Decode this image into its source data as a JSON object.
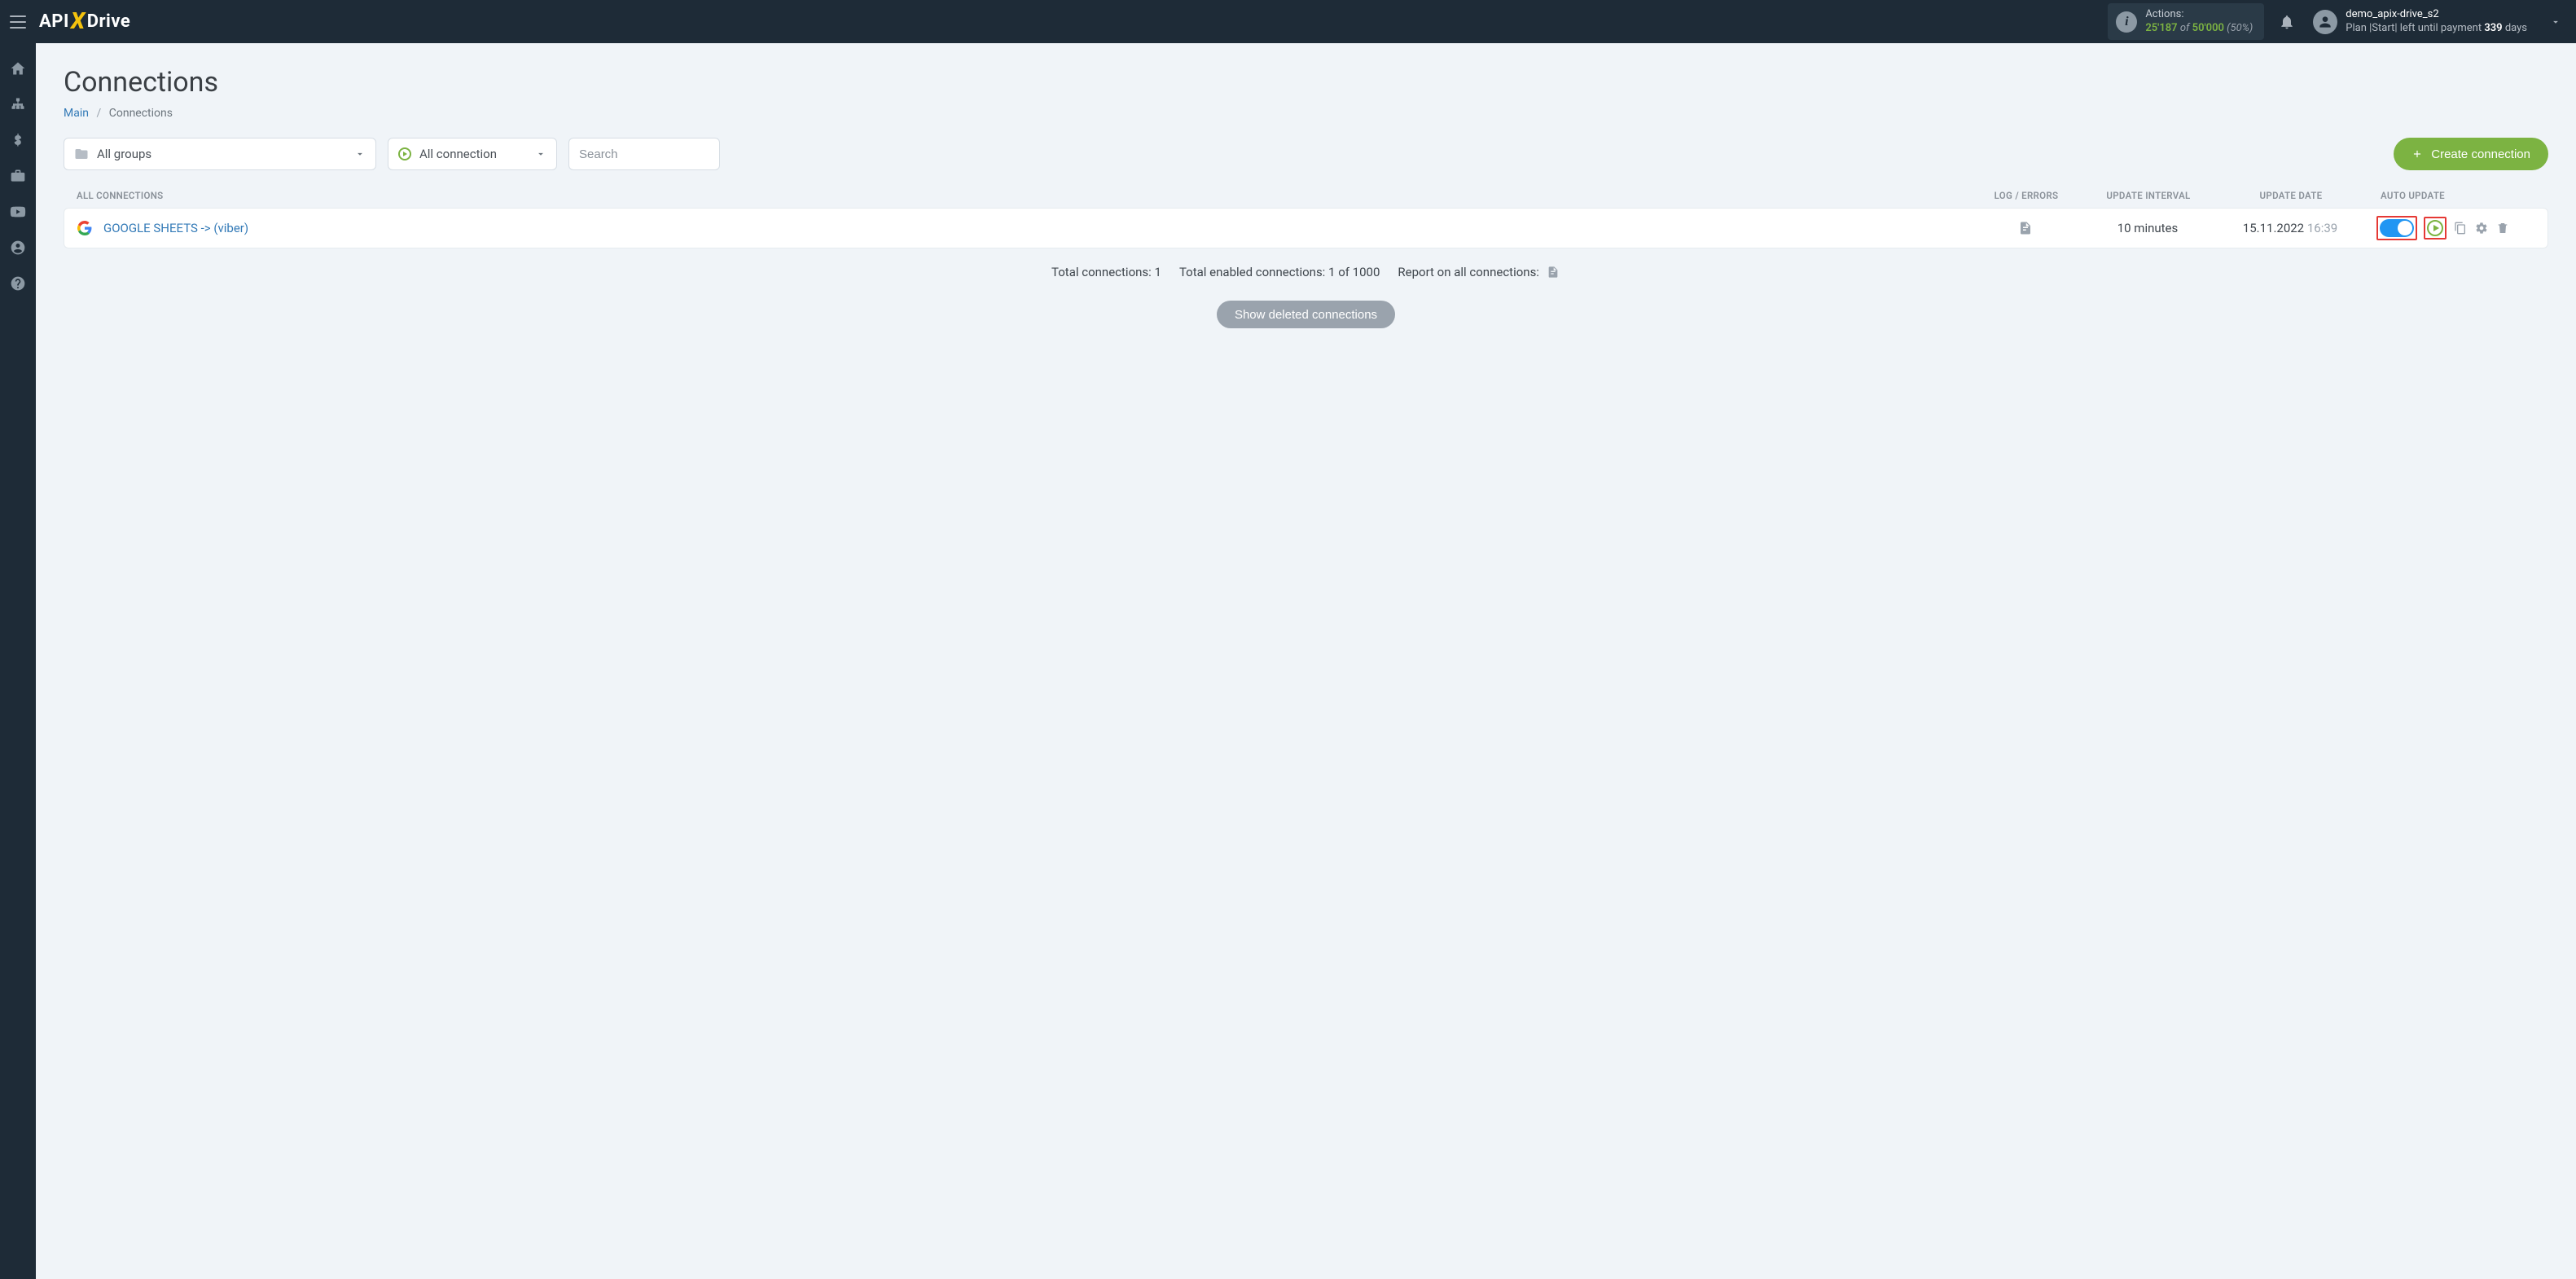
{
  "header": {
    "logo": {
      "part1": "API",
      "part2": "X",
      "part3": "Drive"
    },
    "actions": {
      "label": "Actions:",
      "used": "25'187",
      "of": "of",
      "limit": "50'000",
      "percent": "(50%)"
    },
    "user": {
      "name": "demo_apix-drive_s2",
      "plan_prefix": "Plan |Start| left until payment ",
      "days_value": "339",
      "days_suffix": " days"
    }
  },
  "page": {
    "title": "Connections",
    "breadcrumb": {
      "main": "Main",
      "current": "Connections"
    }
  },
  "filters": {
    "groups_label": "All groups",
    "status_label": "All connection",
    "search_placeholder": "Search",
    "create_button": "Create connection"
  },
  "columns": {
    "name": "ALL CONNECTIONS",
    "log": "LOG / ERRORS",
    "interval": "UPDATE INTERVAL",
    "date": "UPDATE DATE",
    "auto": "AUTO UPDATE"
  },
  "rows": [
    {
      "name": "GOOGLE SHEETS -> (viber)",
      "interval": "10 minutes",
      "date": "15.11.2022",
      "time": "16:39",
      "auto_on": true
    }
  ],
  "stats": {
    "total": "Total connections: 1",
    "enabled": "Total enabled connections: 1 of 1000",
    "report": "Report on all connections:"
  },
  "buttons": {
    "show_deleted": "Show deleted connections"
  }
}
